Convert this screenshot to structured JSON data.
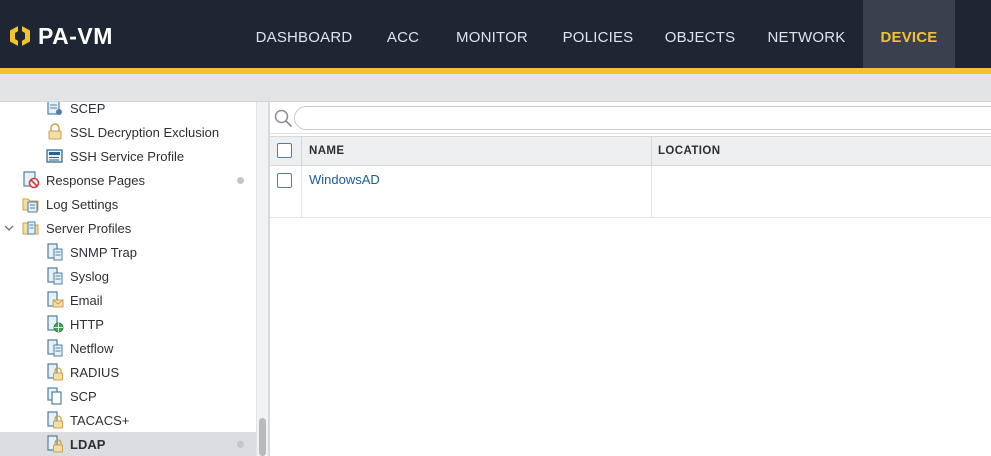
{
  "app": {
    "logo_text": "PA-VM",
    "brand_color": "#f2c230"
  },
  "nav": {
    "tabs": [
      {
        "label": "DASHBOARD",
        "active": false
      },
      {
        "label": "ACC",
        "active": false
      },
      {
        "label": "MONITOR",
        "active": false
      },
      {
        "label": "POLICIES",
        "active": false
      },
      {
        "label": "OBJECTS",
        "active": false
      },
      {
        "label": "NETWORK",
        "active": false
      },
      {
        "label": "DEVICE",
        "active": true
      }
    ]
  },
  "tree": {
    "items": [
      {
        "label": "SCEP",
        "icon": "scep-icon"
      },
      {
        "label": "SSL Decryption Exclusion",
        "icon": "lock-icon"
      },
      {
        "label": "SSH Service Profile",
        "icon": "ssh-profile-icon"
      },
      {
        "label": "Response Pages",
        "icon": "response-pages-icon"
      },
      {
        "label": "Log Settings",
        "icon": "log-settings-icon"
      },
      {
        "label": "Server Profiles",
        "icon": "server-profiles-icon",
        "expanded": true
      },
      {
        "label": "SNMP Trap",
        "icon": "snmp-trap-icon"
      },
      {
        "label": "Syslog",
        "icon": "syslog-icon"
      },
      {
        "label": "Email",
        "icon": "email-icon"
      },
      {
        "label": "HTTP",
        "icon": "http-icon"
      },
      {
        "label": "Netflow",
        "icon": "netflow-icon"
      },
      {
        "label": "RADIUS",
        "icon": "radius-icon"
      },
      {
        "label": "SCP",
        "icon": "scp-icon"
      },
      {
        "label": "TACACS+",
        "icon": "tacacs-icon"
      },
      {
        "label": "LDAP",
        "icon": "ldap-icon",
        "selected": true
      }
    ]
  },
  "search": {
    "value": "",
    "placeholder": ""
  },
  "table": {
    "columns": [
      "NAME",
      "LOCATION"
    ],
    "rows": [
      {
        "name": "WindowsAD",
        "location": ""
      }
    ]
  }
}
